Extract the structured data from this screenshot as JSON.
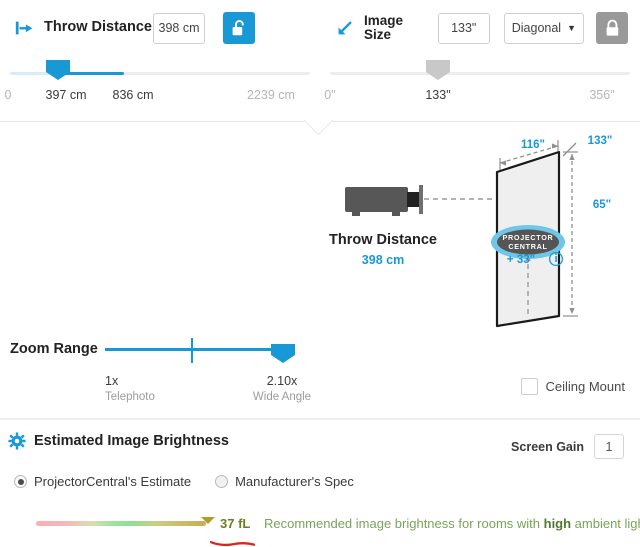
{
  "throw_distance": {
    "icon": "throw-distance-arrow-icon",
    "label": "Throw Distance",
    "value": "398 cm",
    "lock_state": "unlocked",
    "lock_icon": "padlock-open-icon",
    "slider": {
      "min_label": "0",
      "current_label": "397 cm",
      "mid_label": "836 cm",
      "max_label": "2239 cm",
      "handle_pct": 18,
      "fill_end_pct": 38
    }
  },
  "image_size": {
    "icon": "diagonal-arrow-icon",
    "label": "Image\nSize",
    "value": "133\"",
    "unit_option": "Diagonal",
    "caret_icon": "chevron-down-icon",
    "lock_state": "locked",
    "lock_icon": "padlock-closed-icon",
    "slider": {
      "min_label": "0\"",
      "current_label": "133\"",
      "max_label": "356\"",
      "handle_pct": 37
    }
  },
  "diagram": {
    "projector_icon": "projector-icon",
    "throw_label": "Throw Distance",
    "throw_value": "398 cm",
    "screen_width": "116\"",
    "screen_diagonal": "133\"",
    "screen_height": "65\"",
    "offset": "+ 33\"",
    "info_icon": "info-circle-icon",
    "logo_line1": "PROJECTOR",
    "logo_line2": "CENTRAL"
  },
  "zoom_range": {
    "title": "Zoom Range",
    "min_value": "1x",
    "min_sub": "Telephoto",
    "max_value": "2.10x",
    "max_sub": "Wide Angle",
    "ceiling_mount_label": "Ceiling Mount",
    "ceiling_mount_checked": false
  },
  "brightness": {
    "gear_icon": "gear-icon",
    "title": "Estimated Image Brightness",
    "screen_gain_label": "Screen Gain",
    "screen_gain_value": "1",
    "options": [
      {
        "label": "ProjectorCentral's Estimate",
        "checked": true
      },
      {
        "label": "Manufacturer's Spec",
        "checked": false
      }
    ],
    "fl_value": "37 fL",
    "recommendation_prefix": "Recommended image brightness for rooms with ",
    "recommendation_emphasis": "high",
    "recommendation_suffix": " ambient light",
    "marker_icon": "brightness-marker-arrow-icon",
    "annotation_icon": "red-underline-annotation"
  },
  "colors": {
    "accent_blue": "#1899d6",
    "lock_gray": "#999999",
    "green_text": "#7aa35a",
    "olive_text": "#6f7d1e",
    "annotation_red": "#d32b1e"
  }
}
